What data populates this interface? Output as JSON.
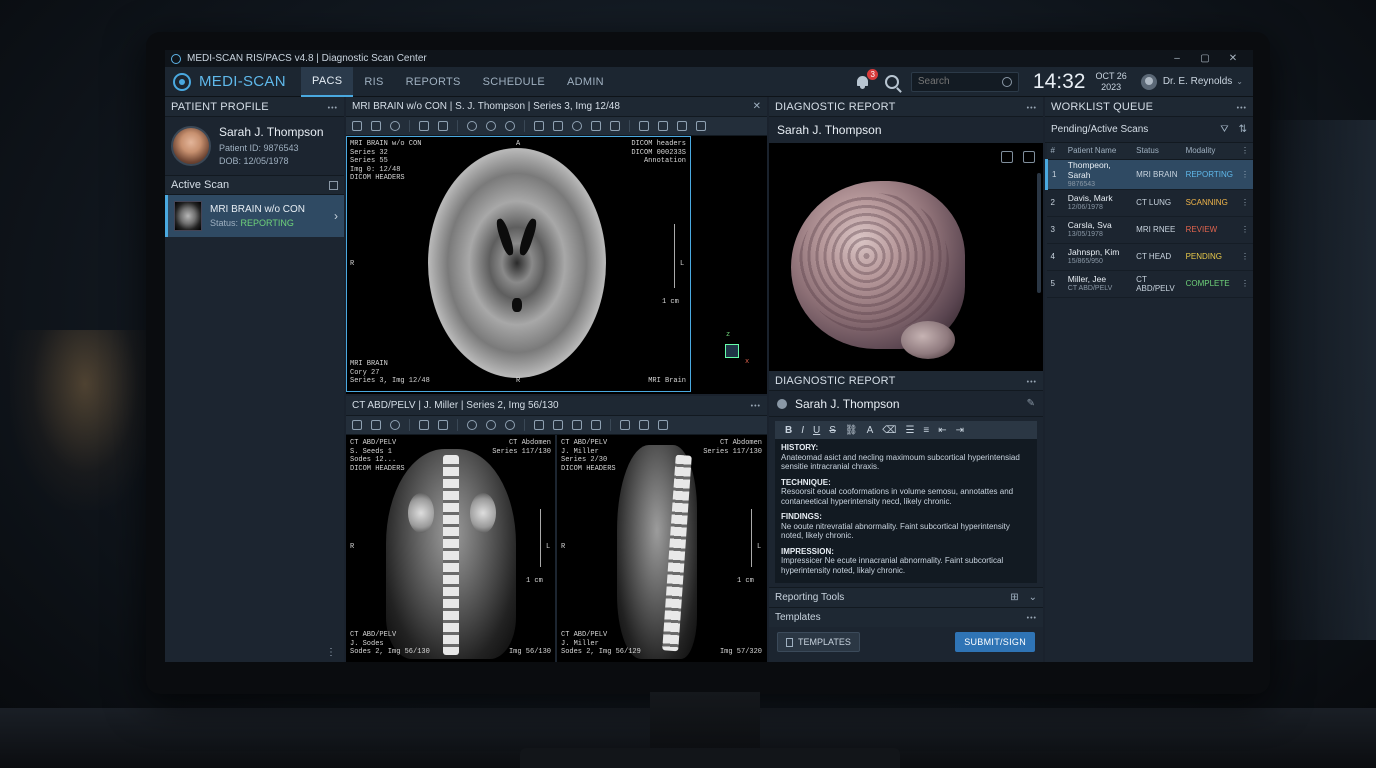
{
  "window": {
    "title": "MEDI-SCAN RIS/PACS v4.8 | Diagnostic Scan Center",
    "minimize": "–",
    "maximize": "▢",
    "close": "✕"
  },
  "nav": {
    "logo": "MEDI-SCAN",
    "tabs": [
      {
        "label": "PACS",
        "active": true
      },
      {
        "label": "RIS",
        "active": false
      },
      {
        "label": "REPORTS",
        "active": false
      },
      {
        "label": "SCHEDULE",
        "active": false
      },
      {
        "label": "ADMIN",
        "active": false
      }
    ],
    "notifications": "3",
    "search_placeholder": "Search",
    "time": "14:32",
    "date_line1": "OCT 26",
    "date_line2": "2023",
    "user": "Dr. E. Reynolds"
  },
  "profile": {
    "title": "PATIENT PROFILE",
    "name": "Sarah J. Thompson",
    "patient_id": "Patient ID: 9876543",
    "dob": "DOB: 12/05/1978",
    "active_scan_title": "Active Scan",
    "scan_title": "MRI BRAIN w/o CON",
    "scan_status_label": "Status: ",
    "scan_status": "REPORTING"
  },
  "viewer_mri": {
    "title": "MRI BRAIN w/o CON | S. J. Thompson | Series 3, Img 12/48",
    "close": "✕",
    "ovl_tl": "MRI BRAIN w/o CON\nSeries 32\nSeries 55\nImg 0: 12/48\nDICOM HEADERS",
    "ovl_tr": "DICOM headers\nDICOM 000233S\nAnnotation",
    "ovl_top": "A",
    "ovl_left": "R",
    "ovl_right": "L",
    "ovl_scale": "1 cm",
    "ovl_bl": "MRI BRAIN\nCory 27\nSeries 3, Img 12/48",
    "ovl_bottom": "R",
    "ovl_br": "MRI Brain",
    "axis_z": "z",
    "axis_x": "x"
  },
  "viewer_ct": {
    "title": "CT ABD/PELV | J. Miller | Series 2, Img 56/130",
    "a_tl": "CT ABD/PELV\nS. Seeds 1\nSodes 12...\nDICOM HEADERS",
    "a_tr": "CT Abdomen\nSeries 117/130",
    "a_left": "R",
    "a_right": "L",
    "a_scale": "1 cm",
    "a_bl": "CT ABD/PELV\nJ. Sodes\nSodes 2, Img 56/130",
    "a_br": "Img 56/130",
    "b_tl": "CT ABD/PELV\nJ. Miller\nSeries 2/30\nDICOM HEADERS",
    "b_tr": "CT Abdomen\nSeries 117/130",
    "b_left": "R",
    "b_right": "L",
    "b_scale": "1 cm",
    "b_bl": "CT ABD/PELV\nJ. Miller\nSodes 2, Img 56/129",
    "b_br": "Img 57/320"
  },
  "report": {
    "title": "DIAGNOSTIC REPORT",
    "patient": "Sarah J. Thompson",
    "title2": "DIAGNOSTIC REPORT",
    "editor_patient": "Sarah J. Thompson",
    "sections": [
      {
        "heading": "HISTORY:",
        "text": "Anateomad asict and necling maximoum subcortical hyperintensiad sensitie intracranial chraxis."
      },
      {
        "heading": "TECHNIQUE:",
        "text": "Resoorsit eoual cooformations in volume semosu, annotattes and contaneetical hyperintensity necd, likely chronic."
      },
      {
        "heading": "FINDINGS:",
        "text": "Ne ooute nitrevratial abnormality. Faint subcortical hyperintensity noted, likely chronic."
      },
      {
        "heading": "IMPRESSION:",
        "text": "Impressicer Ne ecute innacranial abnormality. Faint subcortical hyperintensity noted, likaly chronic."
      }
    ],
    "reporting_tools": "Reporting Tools",
    "templates_title": "Templates",
    "templates_button": "TEMPLATES",
    "submit_button": "SUBMIT/SIGN"
  },
  "worklist": {
    "title": "WORKLIST QUEUE",
    "subtitle": "Pending/Active Scans",
    "columns": [
      "#",
      "Patient Name",
      "Status",
      "Modality"
    ],
    "rows": [
      {
        "num": "1",
        "name": "Thompeon, Sarah",
        "id": "9876543",
        "exam": "MRI BRAIN",
        "status": "REPORTING",
        "color": "#5fb8ea"
      },
      {
        "num": "2",
        "name": "Davis, Mark",
        "id": "12/06/1978",
        "exam": "CT LUNG",
        "status": "SCANNING",
        "color": "#f0b54a"
      },
      {
        "num": "3",
        "name": "Carsla, Sva",
        "id": "13/05/1978",
        "exam": "MRI RNEE",
        "status": "REVIEW",
        "color": "#e0644e"
      },
      {
        "num": "4",
        "name": "Jahnspn, Kim",
        "id": "15/865/950",
        "exam": "CT HEAD",
        "status": "PENDING",
        "color": "#e8c94a"
      },
      {
        "num": "5",
        "name": "Miller, Jee",
        "id": "CT ABD/PELV",
        "exam": "CT ABD/PELV",
        "status": "COMPLETE",
        "color": "#6fd37a"
      }
    ]
  }
}
